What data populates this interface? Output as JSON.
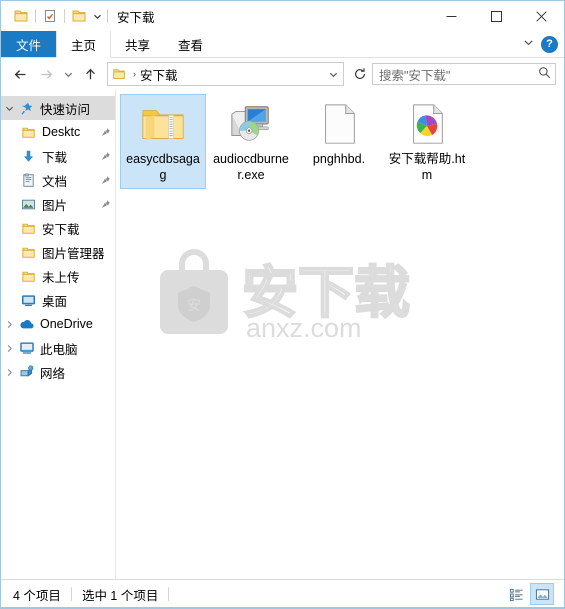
{
  "window": {
    "title": "安下载",
    "quick_access_buttons": [
      "folder-icon",
      "properties-icon",
      "new-folder-icon"
    ],
    "customize_caret": "▾",
    "controls": {
      "minimize": "minimize-icon",
      "maximize": "maximize-icon",
      "close": "close-icon"
    }
  },
  "ribbon": {
    "tabs": [
      {
        "label": "文件",
        "state": "file-menu"
      },
      {
        "label": "主页",
        "state": "inactive"
      },
      {
        "label": "共享",
        "state": "inactive"
      },
      {
        "label": "查看",
        "state": "inactive"
      }
    ],
    "collapse_icon": "chevron-down-icon",
    "help_label": "?",
    "accent_color": "#1a7bc4"
  },
  "address": {
    "back": "back-arrow-icon",
    "forward": "forward-arrow-icon",
    "recent": "chevron-down-icon",
    "up": "up-arrow-icon",
    "breadcrumb": {
      "icon": "folder-icon",
      "separator": "›",
      "path": "安下载"
    },
    "dropdown": "chevron-down-icon",
    "refresh": "refresh-icon"
  },
  "search": {
    "placeholder": "搜索\"安下载\"",
    "icon": "search-icon"
  },
  "sidebar": {
    "items": [
      {
        "label": "快速访问",
        "icon": "star-pin-icon",
        "chevron": "chevron-down-icon",
        "pinned": false,
        "header": true,
        "indent": 0
      },
      {
        "label": "Desktc",
        "icon": "folder-icon",
        "chevron": "",
        "pinned": true,
        "header": false,
        "indent": 1
      },
      {
        "label": "下载",
        "icon": "download-arrow-icon",
        "chevron": "",
        "pinned": true,
        "header": false,
        "indent": 1
      },
      {
        "label": "文档",
        "icon": "documents-icon",
        "chevron": "",
        "pinned": true,
        "header": false,
        "indent": 1
      },
      {
        "label": "图片",
        "icon": "pictures-icon",
        "chevron": "",
        "pinned": true,
        "header": false,
        "indent": 1
      },
      {
        "label": "安下载",
        "icon": "folder-icon",
        "chevron": "",
        "pinned": false,
        "header": false,
        "indent": 1
      },
      {
        "label": "图片管理器",
        "icon": "folder-icon",
        "chevron": "",
        "pinned": false,
        "header": false,
        "indent": 1
      },
      {
        "label": "未上传",
        "icon": "folder-icon",
        "chevron": "",
        "pinned": false,
        "header": false,
        "indent": 1
      },
      {
        "label": "桌面",
        "icon": "desktop-monitor-icon",
        "chevron": "",
        "pinned": false,
        "header": false,
        "indent": 1
      },
      {
        "label": "OneDrive",
        "icon": "cloud-icon",
        "chevron": "chevron-right-icon",
        "pinned": false,
        "header": false,
        "indent": 0
      },
      {
        "label": "此电脑",
        "icon": "this-pc-icon",
        "chevron": "chevron-right-icon",
        "pinned": false,
        "header": false,
        "indent": 0
      },
      {
        "label": "网络",
        "icon": "network-icon",
        "chevron": "chevron-right-icon",
        "pinned": false,
        "header": false,
        "indent": 0
      }
    ]
  },
  "files": [
    {
      "name": "easycdbsagag",
      "icon": "zipped-folder-icon",
      "selected": true
    },
    {
      "name": "audiocdburner.exe",
      "icon": "cd-burner-app-icon",
      "selected": false
    },
    {
      "name": "pnghhbd.",
      "icon": "blank-document-icon",
      "selected": false
    },
    {
      "name": "安下载帮助.htm",
      "icon": "html-pinwheel-icon",
      "selected": false
    }
  ],
  "watermark": {
    "brand_text": "安下载",
    "domain_text": "anxz.com",
    "badge_char": "安",
    "color": "#dcdcdc"
  },
  "statusbar": {
    "item_count": "4 个项目",
    "selection": "选中 1 个项目",
    "views": [
      {
        "name": "details-view",
        "active": false
      },
      {
        "name": "large-icons-view",
        "active": true
      }
    ]
  }
}
